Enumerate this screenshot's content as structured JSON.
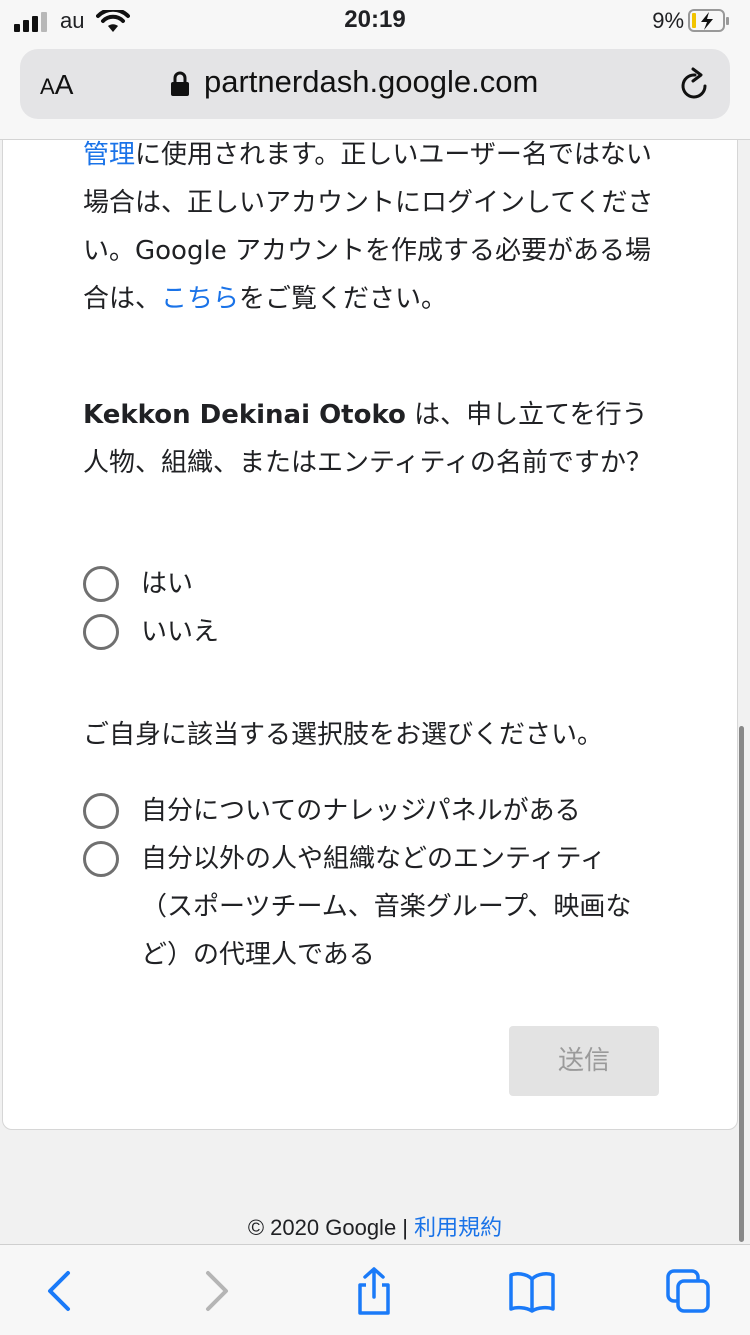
{
  "status_bar": {
    "carrier": "au",
    "time": "20:19",
    "battery": "9%",
    "icons": [
      "signal-icon",
      "wifi-icon",
      "battery-charging-icon"
    ]
  },
  "url_bar": {
    "text_size_label": "AA",
    "url": "partnerdash.google.com",
    "icons": [
      "lock-icon",
      "reload-icon"
    ]
  },
  "intro": {
    "link_manage": "管理",
    "text_1": "に使用されます。正しいユーザー名ではない場合は、正しいアカウントにログインしてください。Google アカウントを作成する必要がある場合は、",
    "link_here": "こちら",
    "text_2": "をご覧ください。"
  },
  "question": {
    "entity_name": "Kekkon Dekinai Otoko",
    "text": " は、申し立てを行う人物、組織、またはエンティティの名前ですか？",
    "options": [
      "はい",
      "いいえ"
    ]
  },
  "role": {
    "prompt": "ご自身に該当する選択肢をお選びください。",
    "options": [
      "自分についてのナレッジパネルがある",
      "自分以外の人や組織などのエンティティ（スポーツチーム、音楽グループ、映画など）の代理人である"
    ]
  },
  "submit_label": "送信",
  "footer": {
    "copyright": "© 2020 Google | ",
    "terms_link": "利用規約"
  },
  "colors": {
    "link": "#1a73e8",
    "radio_border": "#707070",
    "button_disabled_bg": "#e3e3e3",
    "button_disabled_text": "#9a9a9a",
    "safari_blue": "#1a7af8"
  },
  "toolbar": {
    "icons": [
      "back-icon",
      "forward-icon",
      "share-icon",
      "bookmarks-icon",
      "tabs-icon"
    ]
  }
}
